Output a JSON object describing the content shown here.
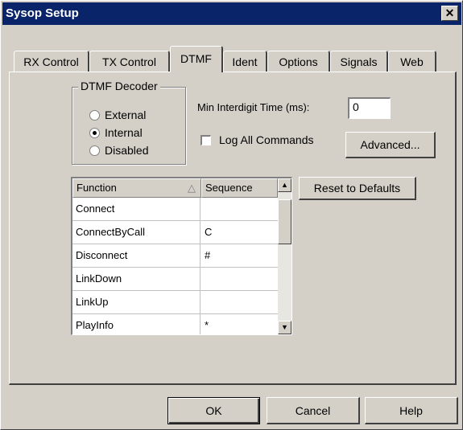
{
  "window": {
    "title": "Sysop Setup",
    "close_glyph": "✕"
  },
  "tabs": [
    {
      "label": "RX Control"
    },
    {
      "label": "TX Control"
    },
    {
      "label": "DTMF",
      "active": true
    },
    {
      "label": "Ident"
    },
    {
      "label": "Options"
    },
    {
      "label": "Signals"
    },
    {
      "label": "Web"
    }
  ],
  "dtmf_decoder": {
    "label": "DTMF Decoder",
    "options": [
      "External",
      "Internal",
      "Disabled"
    ],
    "selected": "Internal"
  },
  "min_interdigit": {
    "label": "Min Interdigit Time (ms):",
    "value": "0"
  },
  "log_all": {
    "label": "Log All Commands",
    "checked": false
  },
  "buttons": {
    "advanced": "Advanced...",
    "reset": "Reset to Defaults",
    "ok": "OK",
    "cancel": "Cancel",
    "help": "Help"
  },
  "table": {
    "columns": [
      "Function",
      "Sequence"
    ],
    "sort_indicator": "△",
    "rows": [
      {
        "function": "Connect",
        "sequence": ""
      },
      {
        "function": "ConnectByCall",
        "sequence": "C"
      },
      {
        "function": "Disconnect",
        "sequence": "#"
      },
      {
        "function": "LinkDown",
        "sequence": ""
      },
      {
        "function": "LinkUp",
        "sequence": ""
      },
      {
        "function": "PlayInfo",
        "sequence": "*"
      }
    ],
    "scroll_up": "▲",
    "scroll_down": "▼"
  }
}
